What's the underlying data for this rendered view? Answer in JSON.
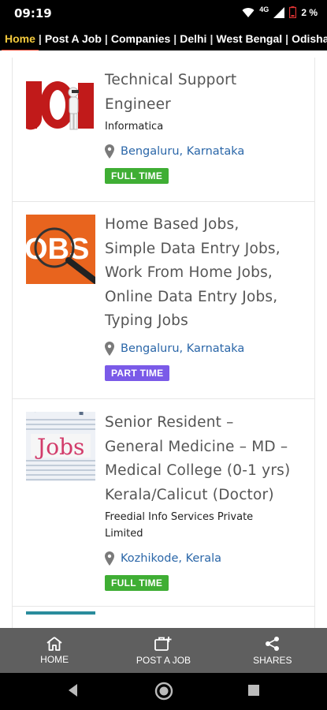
{
  "status_bar": {
    "time": "09:19",
    "network": "4G",
    "battery": "2 %"
  },
  "tabs": [
    {
      "label": "Home",
      "active": true
    },
    {
      "label": "Post A Job",
      "active": false
    },
    {
      "label": "Companies",
      "active": false
    },
    {
      "label": "Delhi",
      "active": false
    },
    {
      "label": "West Bengal",
      "active": false
    },
    {
      "label": "Odisha",
      "active": false
    }
  ],
  "jobs": [
    {
      "title_lines": [
        "Technical Support",
        "Engineer"
      ],
      "company": "Informatica",
      "location": "Bengaluru, Karnataka",
      "type": "FULL TIME",
      "thumb_icon": "job-image"
    },
    {
      "title_lines": [
        "Home Based Jobs,",
        "Simple Data Entry Jobs,",
        "Work From Home Jobs,",
        "Online Data Entry Jobs,",
        "Typing Jobs"
      ],
      "company": "",
      "location": "Bengaluru, Karnataka",
      "type": "PART TIME",
      "thumb_icon": "jobs-magnifier-image",
      "thumb_text": "OBS"
    },
    {
      "title_lines": [
        "Senior Resident –",
        "General Medicine – MD –",
        "Medical College (0-1 yrs)",
        "Kerala/Calicut (Doctor)"
      ],
      "company_lines": [
        "Freedial Info Services Private",
        "Limited"
      ],
      "location": "Kozhikode, Kerala",
      "type": "FULL TIME",
      "thumb_icon": "jobs-newspaper-image",
      "thumb_text": "Jobs"
    }
  ],
  "bottom_nav": {
    "home": "HOME",
    "post": "POST A JOB",
    "shares": "SHARES"
  },
  "colors": {
    "active_tab": "#f3c93d",
    "tab_underline": "#e5412c",
    "link": "#2a66a8",
    "full_time": "#3fae34",
    "part_time": "#7a5ae8",
    "bottom_nav_bg": "#5f5f5f"
  }
}
